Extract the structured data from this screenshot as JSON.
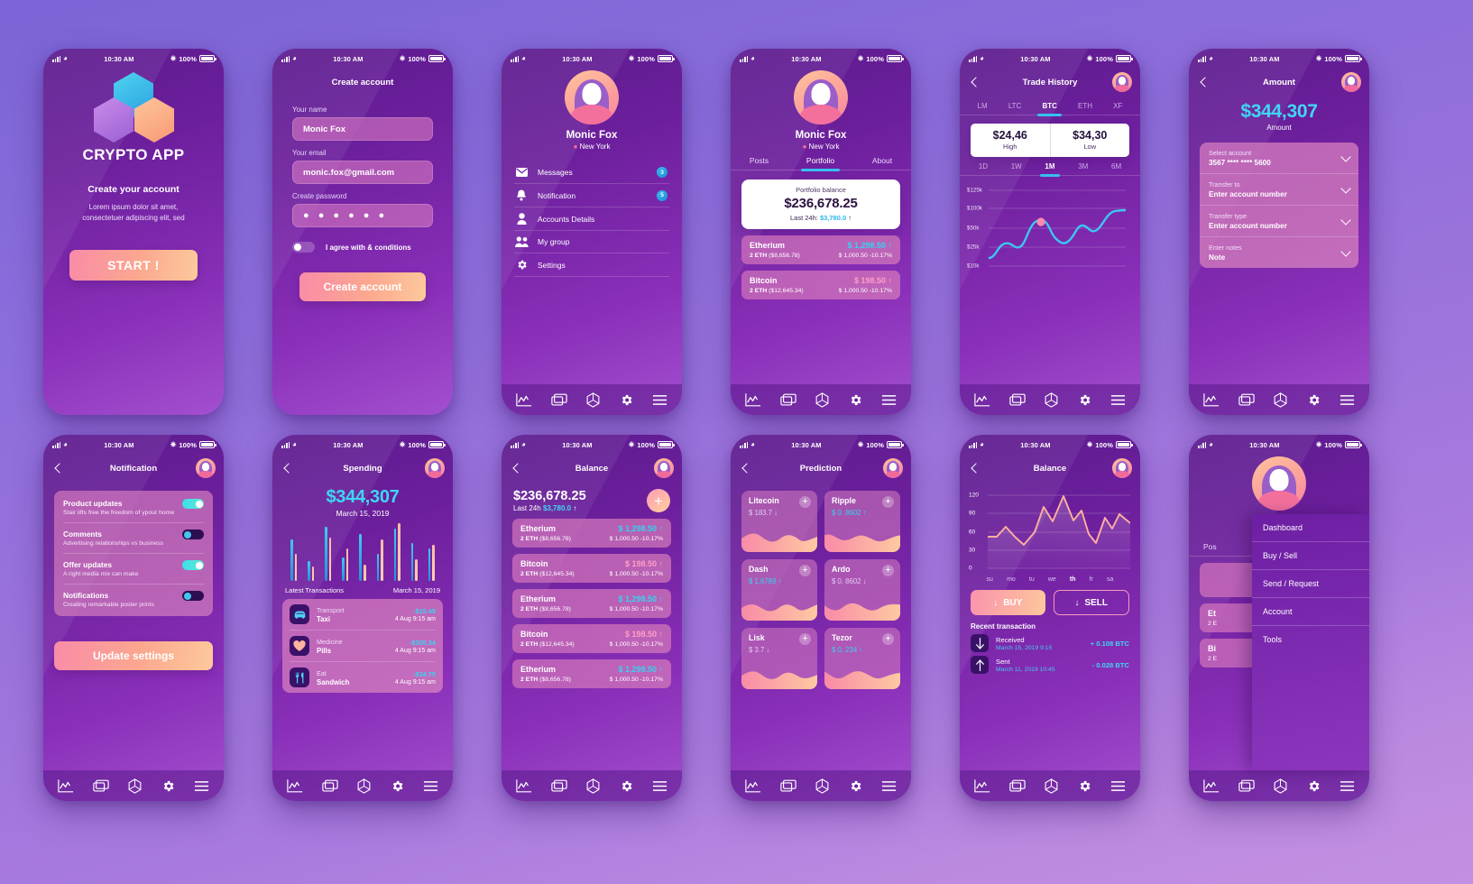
{
  "status_bar": {
    "time": "10:30 AM",
    "battery": "100%",
    "signal_icon": "signal-bars-icon",
    "wifi_icon": "wifi-icon",
    "bluetooth_icon": "bluetooth-icon"
  },
  "bottom_nav": [
    {
      "icon": "chart-line-icon"
    },
    {
      "icon": "cards-layers-icon"
    },
    {
      "icon": "hexagon-cube-icon"
    },
    {
      "icon": "gear-icon"
    },
    {
      "icon": "hamburger-menu-icon"
    }
  ],
  "colors": {
    "accent_cyan": "#35d3f2",
    "accent_pink": "#ff9ec6",
    "brand_purple": "#7b2fb5",
    "cta_gradient_start": "#f98ba8",
    "cta_gradient_end": "#fdc99c"
  },
  "screens": {
    "splash": {
      "app_title": "CRYPTO APP",
      "headline": "Create your account",
      "lorem_line1": "Lorem ipsum dolor sit amet,",
      "lorem_line2": "consectetuer adipiscing elit, sed",
      "start_button": "START !"
    },
    "create_account": {
      "title": "Create account",
      "name_label": "Your name",
      "name_value": "Monic Fox",
      "email_label": "Your email",
      "email_value": "monic.fox@gmail.com",
      "password_label": "Create password",
      "password_value": "● ● ● ● ● ●",
      "agree_text": "I agree with & conditions",
      "submit_button": "Create account"
    },
    "profile_menu": {
      "name": "Monic Fox",
      "location": "New York",
      "items": [
        {
          "label": "Messages",
          "badge": "3",
          "icon": "envelope-icon"
        },
        {
          "label": "Notification",
          "badge": "5",
          "icon": "bell-icon"
        },
        {
          "label": "Accounts Details",
          "badge": "",
          "icon": "person-icon"
        },
        {
          "label": "My group",
          "badge": "",
          "icon": "people-group-icon"
        },
        {
          "label": "Settings",
          "badge": "",
          "icon": "gear-icon"
        }
      ]
    },
    "portfolio": {
      "name": "Monic Fox",
      "location": "New York",
      "tabs": [
        "Posts",
        "Portfolio",
        "About"
      ],
      "active_tab": "Portfolio",
      "balance_caption": "Portfolio balance",
      "balance_amount": "$236,678.25",
      "balance_delta_label": "Last 24h:",
      "balance_delta_value": "$3,780.0",
      "coins": [
        {
          "name": "Etherium",
          "price": "$ 1,298.50",
          "holdings": "2 ETH",
          "value": "($8,656.78)",
          "change": "$ 1,000.50 -10.17%",
          "color": "cyan"
        },
        {
          "name": "Bitcoin",
          "price": "$ 198.50",
          "holdings": "2 ETH",
          "value": "($12,645.34)",
          "change": "$ 1,000.50 -10.17%",
          "color": "pink"
        }
      ]
    },
    "trade_history": {
      "title": "Trade History",
      "crypto_tabs": [
        "LM",
        "LTC",
        "BTC",
        "ETH",
        "XF"
      ],
      "active_crypto": "BTC",
      "high_value": "$24,46",
      "high_label": "High",
      "low_value": "$34,30",
      "low_label": "Low",
      "range_tabs": [
        "1D",
        "1W",
        "1M",
        "3M",
        "6M"
      ],
      "active_range": "1M",
      "y_labels": [
        "$125k",
        "$100k",
        "$50k",
        "$25k",
        "$10k"
      ]
    },
    "amount": {
      "title": "Amount",
      "big_amount": "$344,307",
      "amount_caption": "Amount",
      "rows": [
        {
          "label": "Select account",
          "value": "3567 **** **** 5600"
        },
        {
          "label": "Transfer to",
          "value": "Enter account number"
        },
        {
          "label": "Transfer type",
          "value": "Enter account number"
        },
        {
          "label": "Enter notes",
          "value": "Note"
        }
      ]
    },
    "notification": {
      "title": "Notification",
      "rows": [
        {
          "name": "Product updates",
          "desc": "Stair lifts free the freedom of ypour home",
          "on": true
        },
        {
          "name": "Comments",
          "desc": "Advertising relationships vs business",
          "on": false
        },
        {
          "name": "Offer updates",
          "desc": "A right media mix can make",
          "on": true
        },
        {
          "name": "Notifications",
          "desc": "Creating remarkable poster prints",
          "on": false
        }
      ],
      "button": "Update settings"
    },
    "spending": {
      "title": "Spending",
      "big_amount": "$344,307",
      "date": "March 15, 2019",
      "section_left": "Latest Transactions",
      "section_right": "March 15, 2019",
      "transactions": [
        {
          "category": "Transport",
          "name": "Taxi",
          "amount": "-$15.45",
          "time": "4 Aug  9:15 am",
          "icon": "car-icon"
        },
        {
          "category": "Medicine",
          "name": "Pills",
          "amount": "-$305.34",
          "time": "4 Aug  9:15 am",
          "icon": "heart-icon"
        },
        {
          "category": "Eat",
          "name": "Sandwich",
          "amount": "-$34.75",
          "time": "4 Aug  9:15 am",
          "icon": "fork-knife-icon"
        }
      ]
    },
    "balance_list": {
      "title": "Balance",
      "big_amount": "$236,678.25",
      "sub_label": "Last 24h",
      "sub_value": "$3,780.0",
      "add_button_icon": "plus-icon",
      "coins": [
        {
          "name": "Etherium",
          "price": "$ 1,298.50",
          "holdings": "2 ETH",
          "value": "($8,656.78)",
          "change": "$ 1,000.50 -10.17%",
          "color": "cyan"
        },
        {
          "name": "Bitcoin",
          "price": "$ 198.50",
          "holdings": "2 ETH",
          "value": "($12,645.34)",
          "change": "$ 1,000.50 -10.17%",
          "color": "pink"
        },
        {
          "name": "Etherium",
          "price": "$ 1,298.50",
          "holdings": "2 ETH",
          "value": "($8,656.78)",
          "change": "$ 1,000.50 -10.17%",
          "color": "cyan"
        },
        {
          "name": "Bitcoin",
          "price": "$ 198.50",
          "holdings": "2 ETH",
          "value": "($12,645.34)",
          "change": "$ 1,000.50 -10.17%",
          "color": "pink"
        },
        {
          "name": "Etherium",
          "price": "$ 1,298.50",
          "holdings": "2 ETH",
          "value": "($8,656.78)",
          "change": "$ 1,000.50 -10.17%",
          "color": "cyan"
        }
      ]
    },
    "prediction": {
      "title": "Prediction",
      "cards": [
        {
          "name": "Litecoin",
          "value": "$ 183.7",
          "dir": "down",
          "color": "muted"
        },
        {
          "name": "Ripple",
          "value": "$ 0. 8602",
          "dir": "up",
          "color": "cyan"
        },
        {
          "name": "Dash",
          "value": "$ 1.6789",
          "dir": "up",
          "color": "cyan"
        },
        {
          "name": "Ardo",
          "value": "$ 0. 8602",
          "dir": "down",
          "color": "muted"
        },
        {
          "name": "Lisk",
          "value": "$ 3.7",
          "dir": "down",
          "color": "muted"
        },
        {
          "name": "Tezor",
          "value": "$ 0. 234",
          "dir": "up",
          "color": "cyan"
        }
      ]
    },
    "balance_chart": {
      "title": "Balance",
      "y_labels": [
        "120",
        "90",
        "60",
        "30",
        "0"
      ],
      "day_labels": [
        "su",
        "mo",
        "tu",
        "we",
        "th",
        "fr",
        "sa"
      ],
      "active_day": "th",
      "buy_button": "BUY",
      "sell_button": "SELL",
      "recent_title": "Recent transaction",
      "recent": [
        {
          "kind": "Received",
          "date": "March 15, 2019 9:15",
          "amount": "+ 0.108 BTC",
          "icon": "arrow-down-icon"
        },
        {
          "kind": "Sent",
          "date": "March 11, 2019 10:45",
          "amount": "- 0.028 BTC",
          "icon": "arrow-up-icon"
        }
      ]
    },
    "drawer": {
      "name": "Monic Fox",
      "location": "New York",
      "behind_tab": "Pos",
      "items": [
        "Dashboard",
        "Buy / Sell",
        "Send / Request",
        "Account",
        "Tools"
      ],
      "behind_coins": [
        {
          "name": "Et",
          "sub": "2 E"
        },
        {
          "name": "Bi",
          "sub": "2 E"
        }
      ]
    }
  },
  "chart_data": [
    {
      "type": "line",
      "title": "BTC price — 1M",
      "ylabel": "",
      "xlabel": "",
      "ytick_labels": [
        "$125k",
        "$100k",
        "$50k",
        "$25k",
        "$10k"
      ],
      "yticks": [
        125,
        100,
        50,
        25,
        10
      ],
      "ylim": [
        0,
        140
      ],
      "grid": true,
      "legend": "none",
      "x": [
        0,
        1,
        2,
        3,
        4,
        5,
        6,
        7,
        8,
        9,
        10,
        11,
        12,
        13,
        14
      ],
      "values": [
        13,
        22,
        26,
        24,
        34,
        50,
        57,
        47,
        34,
        38,
        46,
        42,
        52,
        63,
        66
      ],
      "marker_point": {
        "x": 6,
        "y": 47,
        "color": "#f98bb0"
      },
      "line_color": "#3ec6f0"
    },
    {
      "type": "bar",
      "title": "Spending — $344,307 — March 15, 2019",
      "xlabel": "",
      "ylabel": "",
      "categories": [
        "1",
        "2",
        "3",
        "4",
        "5",
        "6",
        "7",
        "8",
        "9"
      ],
      "series": [
        {
          "name": "blue",
          "color": "#3fc9f2",
          "values": [
            46,
            22,
            60,
            26,
            52,
            30,
            58,
            42,
            36
          ]
        },
        {
          "name": "pink",
          "color": "#ffc0ac",
          "values": [
            30,
            16,
            48,
            36,
            18,
            46,
            64,
            24,
            40
          ]
        }
      ],
      "ylim": [
        0,
        70
      ],
      "grid": false,
      "legend": "none"
    },
    {
      "type": "line",
      "title": "Weekly balance",
      "xlabel": "",
      "ylabel": "",
      "ytick_labels": [
        "0",
        "30",
        "60",
        "90",
        "120"
      ],
      "yticks": [
        0,
        30,
        60,
        90,
        120
      ],
      "ylim": [
        0,
        130
      ],
      "grid": true,
      "legend": "none",
      "categories": [
        "su",
        "mo",
        "tu",
        "we",
        "th",
        "fr",
        "sa"
      ],
      "x": [
        0,
        1,
        2,
        3,
        4,
        5,
        6,
        7,
        8,
        9,
        10,
        11,
        12,
        13,
        14,
        15,
        16
      ],
      "values": [
        50,
        70,
        52,
        38,
        60,
        95,
        72,
        112,
        78,
        88,
        58,
        42,
        74,
        55,
        86,
        62,
        80
      ],
      "line_color": "#ffb0a0",
      "area_fill": true
    }
  ]
}
